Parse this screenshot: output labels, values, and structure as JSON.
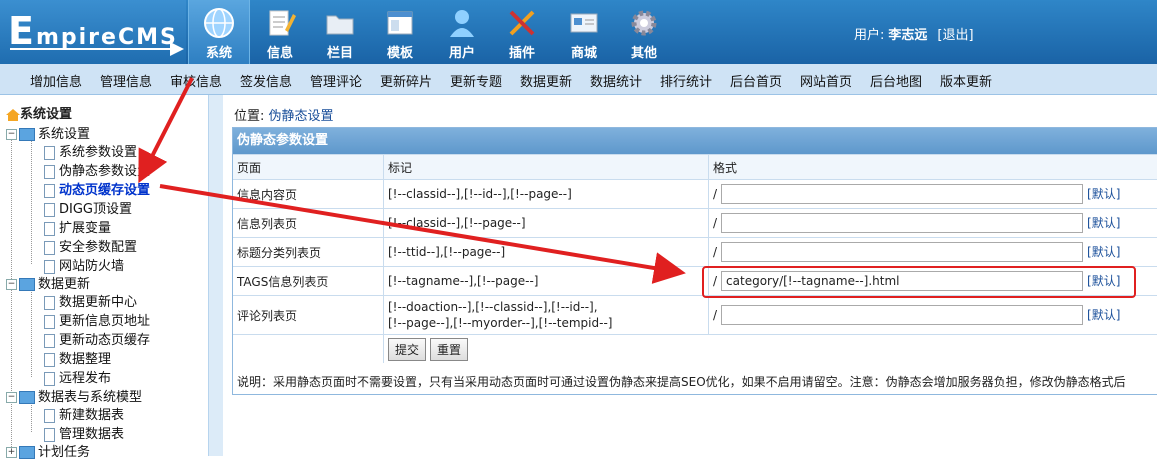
{
  "header": {
    "logo_prefix": "E",
    "logo_text": "mpireCMS",
    "topnav": [
      "系统",
      "信息",
      "栏目",
      "模板",
      "用户",
      "插件",
      "商城",
      "其他"
    ],
    "user_label": "用户:",
    "user_name": "李志远",
    "logout": "[退出]"
  },
  "subnav": [
    "增加信息",
    "管理信息",
    "审核信息",
    "签发信息",
    "管理评论",
    "更新碎片",
    "更新专题",
    "数据更新",
    "数据统计",
    "排行统计",
    "后台首页",
    "网站首页",
    "后台地图",
    "版本更新"
  ],
  "sidebar": {
    "root": "系统设置",
    "groups": [
      {
        "label": "系统设置",
        "items": [
          "系统参数设置",
          "伪静态参数设置",
          "动态页缓存设置",
          "DIGG顶设置",
          "扩展变量",
          "安全参数配置",
          "网站防火墙"
        ]
      },
      {
        "label": "数据更新",
        "items": [
          "数据更新中心",
          "更新信息页地址",
          "更新动态页缓存",
          "数据整理",
          "远程发布"
        ]
      },
      {
        "label": "数据表与系统模型",
        "items": [
          "新建数据表",
          "管理数据表"
        ]
      },
      {
        "label": "计划任务",
        "items": []
      }
    ]
  },
  "breadcrumb": {
    "label": "位置:",
    "link": "伪静态设置"
  },
  "panel": {
    "title": "伪静态参数设置",
    "headers": [
      "页面",
      "标记",
      "格式"
    ],
    "rows": [
      {
        "page": "信息内容页",
        "tag1": "[!--classid--],[!--id--],[!--page--]",
        "tag2": "",
        "value": ""
      },
      {
        "page": "信息列表页",
        "tag1": "[!--classid--],[!--page--]",
        "tag2": "",
        "value": ""
      },
      {
        "page": "标题分类列表页",
        "tag1": "[!--ttid--],[!--page--]",
        "tag2": "",
        "value": ""
      },
      {
        "page": "TAGS信息列表页",
        "tag1": "[!--tagname--],[!--page--]",
        "tag2": "",
        "value": "category/[!--tagname--].html"
      },
      {
        "page": "评论列表页",
        "tag1": "[!--doaction--],[!--classid--],[!--id--],",
        "tag2": "[!--page--],[!--myorder--],[!--tempid--]",
        "value": ""
      }
    ],
    "slash": "/",
    "default_label": "[默认]",
    "submit": "提交",
    "reset": "重置",
    "note": "说明：采用静态页面时不需要设置，只有当采用动态页面时可通过设置伪静态来提高SEO优化，如果不启用请留空。注意：伪静态会增加服务器负担，修改伪静态格式后"
  },
  "colors": {
    "header_bg": "#1a63a6",
    "subnav_bg": "#cfe3f5",
    "panel_title": "#5e98cc",
    "annotation": "#e02020"
  }
}
